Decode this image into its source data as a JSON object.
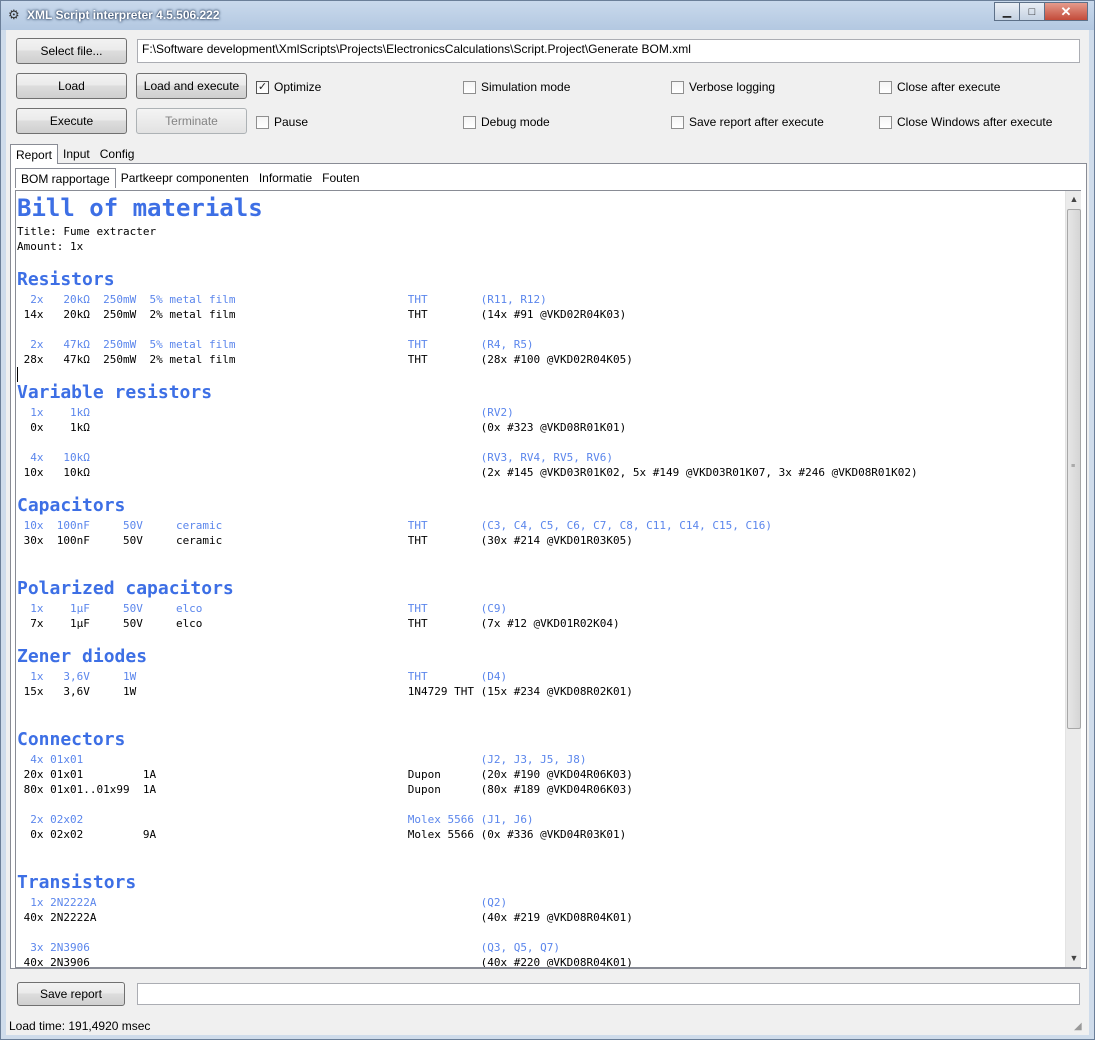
{
  "window": {
    "title": "XML Script interpreter 4.5.506.222",
    "minimize": "▁",
    "maximize": "□",
    "close": "✕",
    "app_icon": "⚙"
  },
  "toolbar": {
    "select_file": "Select file...",
    "path": "F:\\Software development\\XmlScripts\\Projects\\ElectronicsCalculations\\Script.Project\\Generate BOM.xml",
    "load": "Load",
    "load_execute": "Load and execute",
    "execute": "Execute",
    "terminate": "Terminate"
  },
  "options": [
    {
      "label": "Optimize",
      "checked": true
    },
    {
      "label": "Simulation mode",
      "checked": false
    },
    {
      "label": "Verbose logging",
      "checked": false
    },
    {
      "label": "Close after execute",
      "checked": false
    },
    {
      "label": "Pause",
      "checked": false
    },
    {
      "label": "Debug mode",
      "checked": false
    },
    {
      "label": "Save report after execute",
      "checked": false
    },
    {
      "label": "Close Windows after execute",
      "checked": false
    }
  ],
  "outer_tabs": [
    "Report",
    "Input",
    "Config"
  ],
  "inner_tabs": [
    "BOM rapportage",
    "Partkeepr componenten",
    "Informatie",
    "Fouten"
  ],
  "report": {
    "title": "Bill of materials",
    "title_line": "Title: Fume extracter",
    "amount_line": "Amount: 1x",
    "sections": {
      "resistors": "Resistors",
      "variable_resistors": "Variable resistors",
      "capacitors": "Capacitors",
      "polarized_capacitors": "Polarized capacitors",
      "zener_diodes": "Zener diodes",
      "connectors": "Connectors",
      "transistors": "Transistors"
    },
    "lines": {
      "r1a": "  2x   20kΩ  250mW  5% metal film                          THT        (R11, R12)",
      "r1b": " 14x   20kΩ  250mW  2% metal film                          THT        (14x #91 @VKD02R04K03)",
      "r2a": "  2x   47kΩ  250mW  5% metal film                          THT        (R4, R5)",
      "r2b": " 28x   47kΩ  250mW  2% metal film                          THT        (28x #100 @VKD02R04K05)",
      "v1a": "  1x    1kΩ                                                           (RV2)",
      "v1b": "  0x    1kΩ                                                           (0x #323 @VKD08R01K01)",
      "v2a": "  4x   10kΩ                                                           (RV3, RV4, RV5, RV6)",
      "v2b": " 10x   10kΩ                                                           (2x #145 @VKD03R01K02, 5x #149 @VKD03R01K07, 3x #246 @VKD08R01K02)",
      "c1a": " 10x  100nF     50V     ceramic                            THT        (C3, C4, C5, C6, C7, C8, C11, C14, C15, C16)",
      "c1b": " 30x  100nF     50V     ceramic                            THT        (30x #214 @VKD01R03K05)",
      "p1a": "  1x    1µF     50V     elco                               THT        (C9)",
      "p1b": "  7x    1µF     50V     elco                               THT        (7x #12 @VKD01R02K04)",
      "z1a": "  1x   3,6V     1W                                         THT        (D4)",
      "z1b": " 15x   3,6V     1W                                         1N4729 THT (15x #234 @VKD08R02K01)",
      "k1a": "  4x 01x01                                                            (J2, J3, J5, J8)",
      "k1b": " 20x 01x01         1A                                      Dupon      (20x #190 @VKD04R06K03)",
      "k1c": " 80x 01x01..01x99  1A                                      Dupon      (80x #189 @VKD04R06K03)",
      "k2a": "  2x 02x02                                                 Molex 5566 (J1, J6)",
      "k2b": "  0x 02x02         9A                                      Molex 5566 (0x #336 @VKD04R03K01)",
      "t1a": "  1x 2N2222A                                                          (Q2)",
      "t1b": " 40x 2N2222A                                                          (40x #219 @VKD08R04K01)",
      "t2a": "  3x 2N3906                                                           (Q3, Q5, Q7)",
      "t2b": " 40x 2N3906                                                           (40x #220 @VKD08R04K01)"
    }
  },
  "bottom": {
    "save_report": "Save report",
    "status": "Load time: 191,4920 msec"
  },
  "colors": {
    "heading": "#3d6fe5",
    "required_line": "#5b86ec"
  }
}
